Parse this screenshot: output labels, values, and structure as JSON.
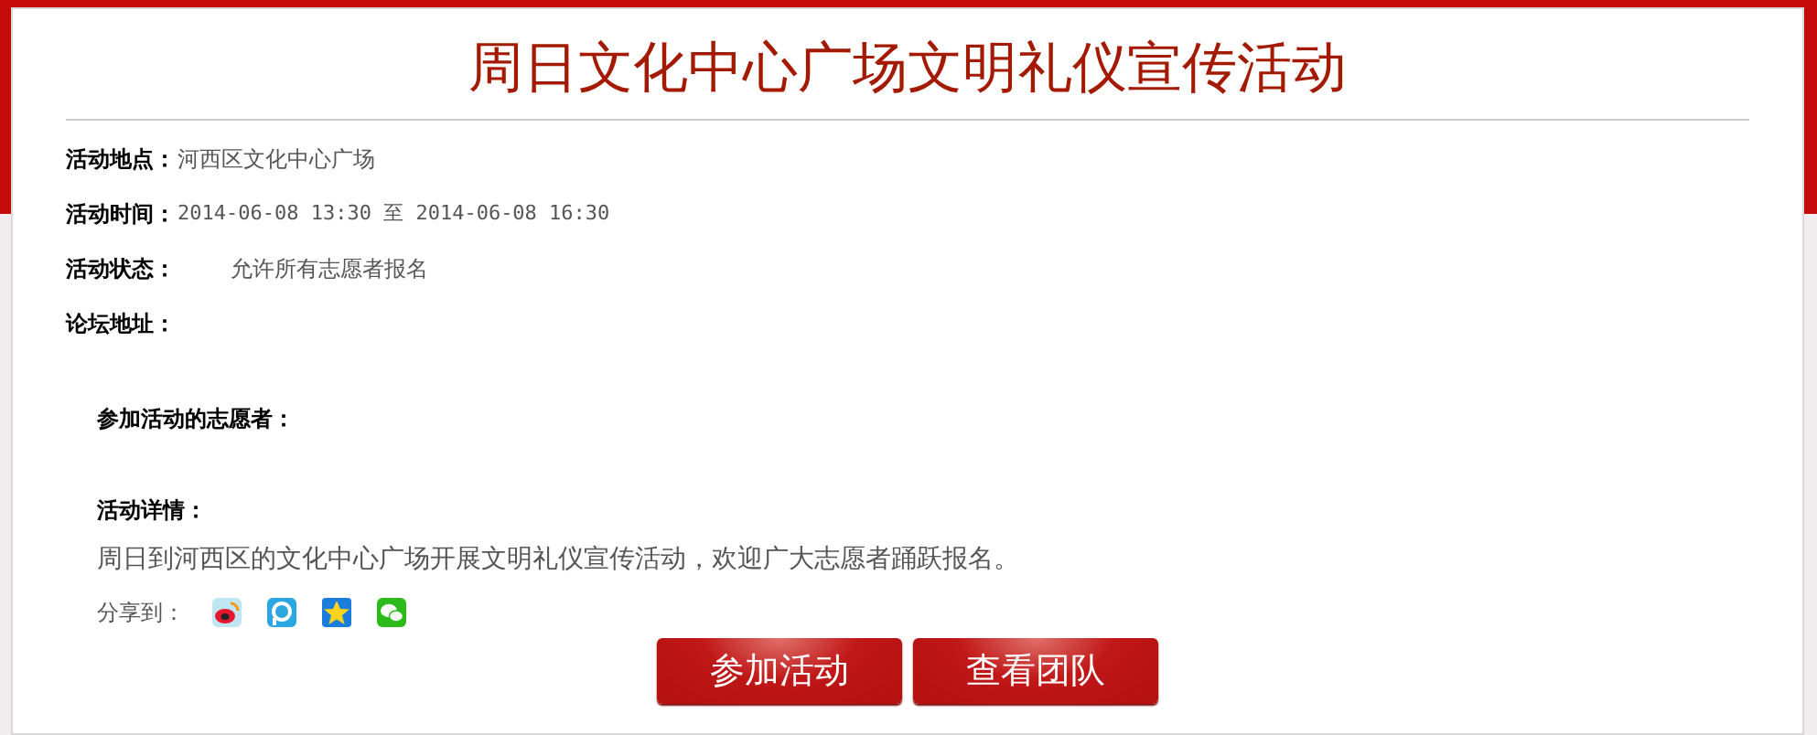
{
  "title": "周日文化中心广场文明礼仪宣传活动",
  "info_rows": [
    {
      "label": "活动地点：",
      "value": "河西区文化中心广场",
      "kind": "text"
    },
    {
      "label": "活动时间：",
      "value": "2014-06-08 13:30 至 2014-06-08 16:30",
      "kind": "mono"
    },
    {
      "label": "活动状态：",
      "value": "允许所有志愿者报名",
      "kind": "indented"
    },
    {
      "label": "论坛地址："
    }
  ],
  "volunteers": {
    "label": "参加活动的志愿者："
  },
  "details": {
    "label": "活动详情：",
    "text": "周日到河西区的文化中心广场开展文明礼仪宣传活动，欢迎广大志愿者踊跃报名。"
  },
  "share": {
    "label": "分享到：",
    "icons": [
      {
        "kind": "swirl"
      },
      {
        "kind": "ring"
      },
      {
        "kind": "star"
      },
      {
        "kind": "chat"
      }
    ]
  },
  "buttons": [
    "参加活动",
    "查看团队"
  ]
}
